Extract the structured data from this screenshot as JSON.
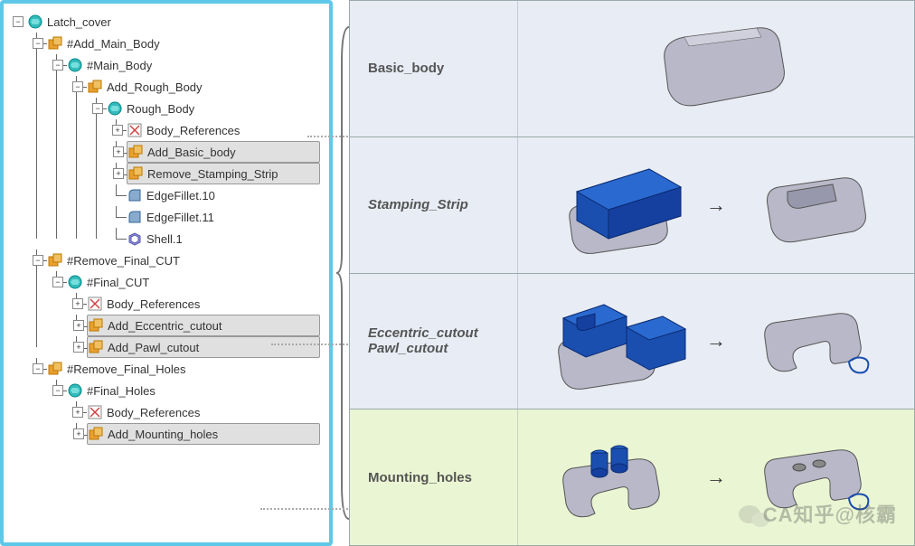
{
  "tree": {
    "root": "Latch_cover",
    "add_main": "#Add_Main_Body",
    "main_body": "#Main_Body",
    "add_rough": "Add_Rough_Body",
    "rough_body": "Rough_Body",
    "body_refs": "Body_References",
    "add_basic": "Add_Basic_body",
    "remove_stamp": "Remove_Stamping_Strip",
    "fillet10": "EdgeFillet.10",
    "fillet11": "EdgeFillet.11",
    "shell1": "Shell.1",
    "remove_final_cut": "#Remove_Final_CUT",
    "final_cut": "#Final_CUT",
    "body_refs2": "Body_References",
    "add_ecc": "Add_Eccentric_cutout",
    "add_pawl": "Add_Pawl_cutout",
    "remove_final_holes": "#Remove_Final_Holes",
    "final_holes": "#Final_Holes",
    "body_refs3": "Body_References",
    "add_mount": "Add_Mounting_holes"
  },
  "stages": {
    "s1": "Basic_body",
    "s2": "Stamping_Strip",
    "s3a": "Eccentric_cutout",
    "s3b": "Pawl_cutout",
    "s4": "Mounting_holes"
  },
  "watermark": "CA知乎@核霸"
}
